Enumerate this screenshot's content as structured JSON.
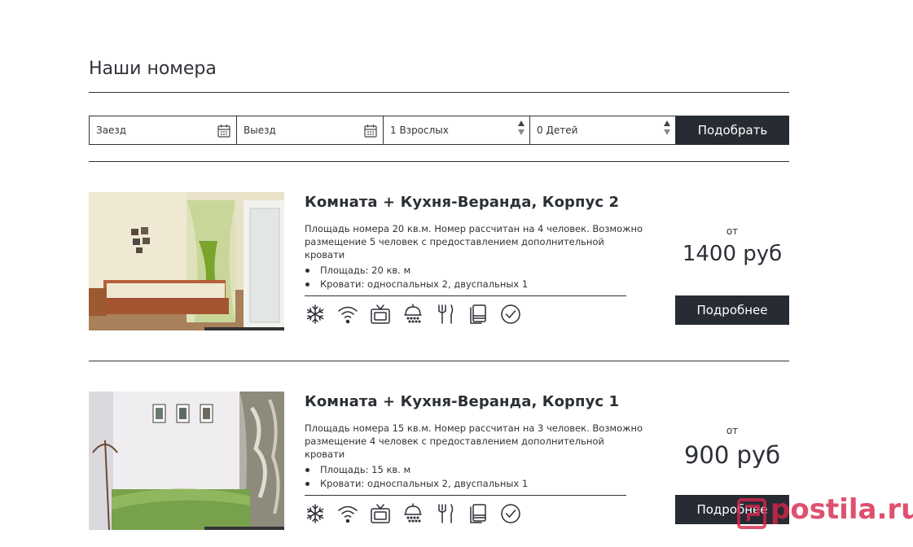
{
  "page": {
    "title": "Наши номера"
  },
  "filter": {
    "checkin_placeholder": "Заезд",
    "checkout_placeholder": "Выезд",
    "adults_value": "1 Взрослых",
    "children_value": "0 Детей",
    "submit_label": "Подобрать"
  },
  "rooms": [
    {
      "name": "Комната + Кухня-Веранда, Корпус 2",
      "description": "Площадь номера 20 кв.м. Номер рассчитан на 4 человек. Возможно размещение 5 человек с предоставлением дополнительной кровати",
      "features": [
        "Площадь: 20 кв. м",
        "Кровати: односпальных 2, двуспальных 1"
      ],
      "price_prefix": "от",
      "price": "1400 руб",
      "button_label": "Подробнее"
    },
    {
      "name": "Комната + Кухня-Веранда, Корпус 1",
      "description": "Площадь номера 15 кв.м. Номер рассчитан на 3 человек. Возможно размещение 4 человек с предоставлением дополнительной кровати",
      "features": [
        "Площадь: 15 кв. м",
        "Кровати: односпальных 2, двуспальных 1"
      ],
      "price_prefix": "от",
      "price": "900 руб",
      "button_label": "Подробнее"
    }
  ],
  "amenity_icons": [
    "snowflake-icon",
    "wifi-icon",
    "tv-icon",
    "shower-icon",
    "cutlery-icon",
    "towel-icon",
    "check-circle-icon"
  ],
  "colors": {
    "accent_dark": "#272b33",
    "text": "#2b2f36",
    "watermark": "#d6264b"
  },
  "watermark": "postila.ru"
}
